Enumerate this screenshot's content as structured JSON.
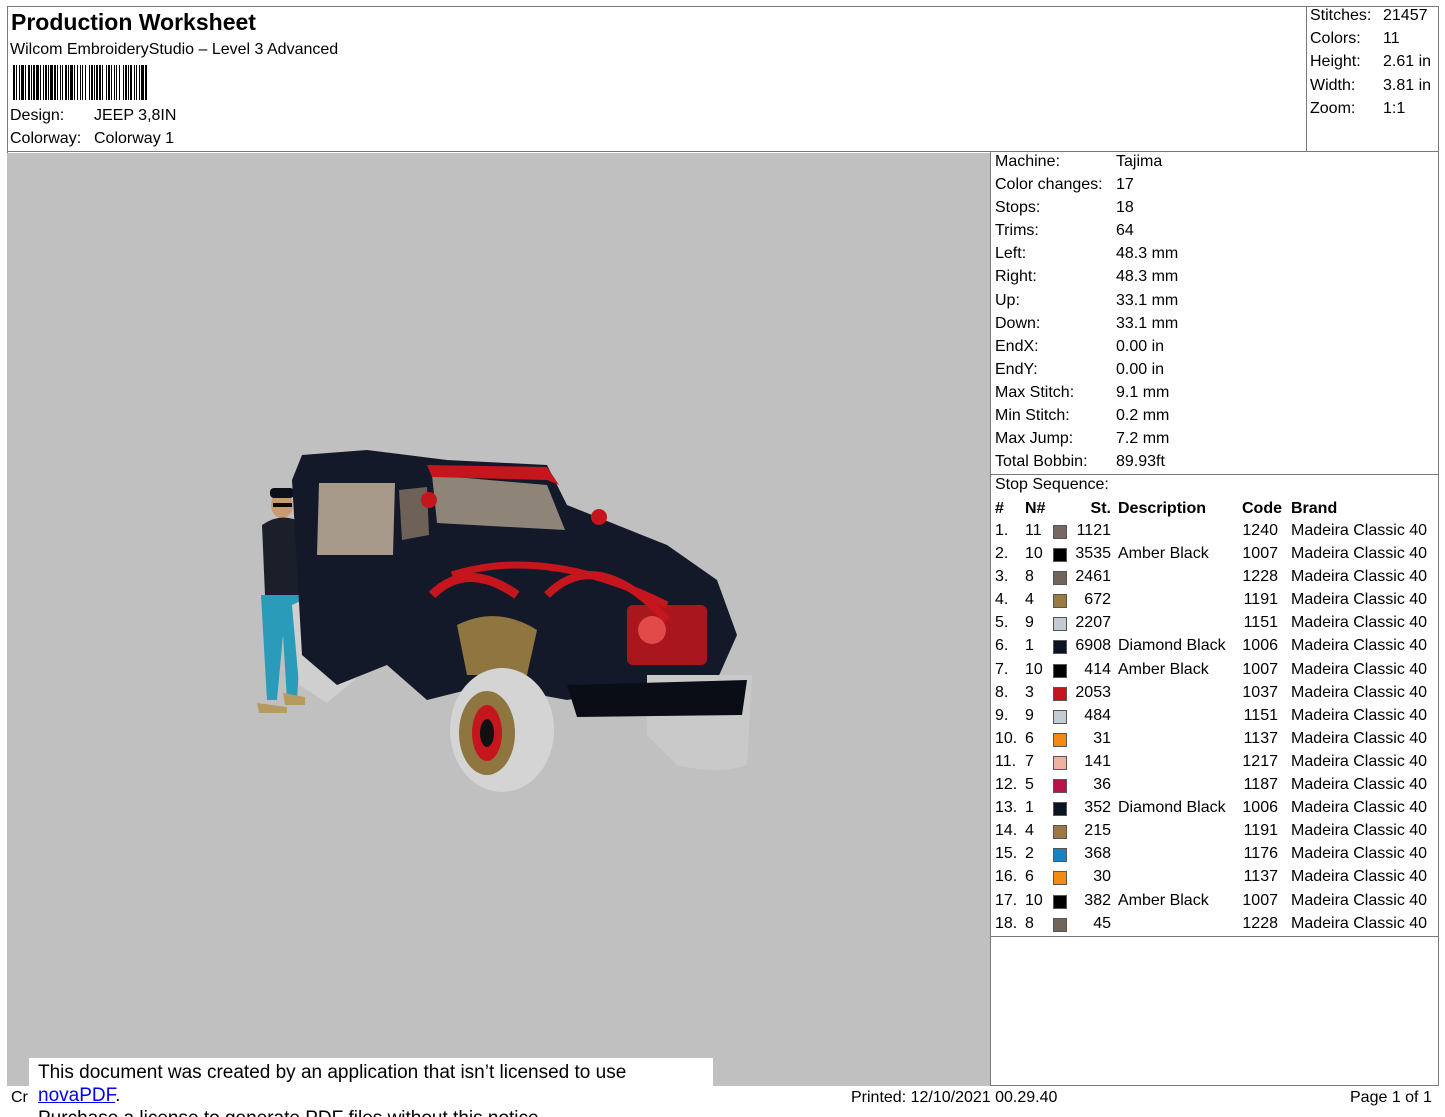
{
  "header": {
    "title": "Production Worksheet",
    "software": "Wilcom EmbroideryStudio – Level 3 Advanced",
    "design_label": "Design:",
    "design_value": "JEEP 3,8IN",
    "colorway_label": "Colorway:",
    "colorway_value": "Colorway 1"
  },
  "stats": [
    {
      "label": "Stitches:",
      "value": "21457"
    },
    {
      "label": "Colors:",
      "value": "11"
    },
    {
      "label": "Height:",
      "value": "2.61 in"
    },
    {
      "label": "Width:",
      "value": "3.81 in"
    },
    {
      "label": "Zoom:",
      "value": "1:1"
    }
  ],
  "machine": [
    {
      "label": "Machine:",
      "value": "Tajima"
    },
    {
      "label": "Color changes:",
      "value": "17"
    },
    {
      "label": "Stops:",
      "value": "18"
    },
    {
      "label": "Trims:",
      "value": "64"
    },
    {
      "label": "Left:",
      "value": "48.3 mm"
    },
    {
      "label": "Right:",
      "value": "48.3 mm"
    },
    {
      "label": "Up:",
      "value": "33.1 mm"
    },
    {
      "label": "Down:",
      "value": "33.1 mm"
    },
    {
      "label": "EndX:",
      "value": "0.00 in"
    },
    {
      "label": "EndY:",
      "value": "0.00 in"
    },
    {
      "label": "Max Stitch:",
      "value": "9.1 mm"
    },
    {
      "label": "Min Stitch:",
      "value": "0.2 mm"
    },
    {
      "label": "Max Jump:",
      "value": "7.2 mm"
    },
    {
      "label": "Total Bobbin:",
      "value": "89.93ft"
    }
  ],
  "stop_sequence": {
    "label": "Stop Sequence:",
    "columns": {
      "idx": "#",
      "n": "N#",
      "st": "St.",
      "desc": "Description",
      "code": "Code",
      "brand": "Brand"
    },
    "rows": [
      {
        "idx": "1.",
        "n": "11",
        "color": "#766860",
        "st": "1121",
        "desc": "",
        "code": "1240",
        "brand": "Madeira Classic 40"
      },
      {
        "idx": "2.",
        "n": "10",
        "color": "#000000",
        "st": "3535",
        "desc": "Amber Black",
        "code": "1007",
        "brand": "Madeira Classic 40"
      },
      {
        "idx": "3.",
        "n": "8",
        "color": "#6f655c",
        "st": "2461",
        "desc": "",
        "code": "1228",
        "brand": "Madeira Classic 40"
      },
      {
        "idx": "4.",
        "n": "4",
        "color": "#9a7a42",
        "st": "672",
        "desc": "",
        "code": "1191",
        "brand": "Madeira Classic 40"
      },
      {
        "idx": "5.",
        "n": "9",
        "color": "#c4cbd2",
        "st": "2207",
        "desc": "",
        "code": "1151",
        "brand": "Madeira Classic 40"
      },
      {
        "idx": "6.",
        "n": "1",
        "color": "#0b1422",
        "st": "6908",
        "desc": "Diamond Black",
        "code": "1006",
        "brand": "Madeira Classic 40"
      },
      {
        "idx": "7.",
        "n": "10",
        "color": "#000000",
        "st": "414",
        "desc": "Amber Black",
        "code": "1007",
        "brand": "Madeira Classic 40"
      },
      {
        "idx": "8.",
        "n": "3",
        "color": "#c4161c",
        "st": "2053",
        "desc": "",
        "code": "1037",
        "brand": "Madeira Classic 40"
      },
      {
        "idx": "9.",
        "n": "9",
        "color": "#c4cbd2",
        "st": "484",
        "desc": "",
        "code": "1151",
        "brand": "Madeira Classic 40"
      },
      {
        "idx": "10.",
        "n": "6",
        "color": "#f58a12",
        "st": "31",
        "desc": "",
        "code": "1137",
        "brand": "Madeira Classic 40"
      },
      {
        "idx": "11.",
        "n": "7",
        "color": "#f0b2a0",
        "st": "141",
        "desc": "",
        "code": "1217",
        "brand": "Madeira Classic 40"
      },
      {
        "idx": "12.",
        "n": "5",
        "color": "#b8134a",
        "st": "36",
        "desc": "",
        "code": "1187",
        "brand": "Madeira Classic 40"
      },
      {
        "idx": "13.",
        "n": "1",
        "color": "#0b1422",
        "st": "352",
        "desc": "Diamond Black",
        "code": "1006",
        "brand": "Madeira Classic 40"
      },
      {
        "idx": "14.",
        "n": "4",
        "color": "#9a7a42",
        "st": "215",
        "desc": "",
        "code": "1191",
        "brand": "Madeira Classic 40"
      },
      {
        "idx": "15.",
        "n": "2",
        "color": "#1a82c0",
        "st": "368",
        "desc": "",
        "code": "1176",
        "brand": "Madeira Classic 40"
      },
      {
        "idx": "16.",
        "n": "6",
        "color": "#f58a12",
        "st": "30",
        "desc": "",
        "code": "1137",
        "brand": "Madeira Classic 40"
      },
      {
        "idx": "17.",
        "n": "10",
        "color": "#000000",
        "st": "382",
        "desc": "Amber Black",
        "code": "1007",
        "brand": "Madeira Classic 40"
      },
      {
        "idx": "18.",
        "n": "8",
        "color": "#6f655c",
        "st": "45",
        "desc": "",
        "code": "1228",
        "brand": "Madeira Classic 40"
      }
    ]
  },
  "notice": {
    "line1_prefix": "This document was created by an application that isn’t licensed to use ",
    "link": "novaPDF",
    "line1_suffix": ".",
    "line2": "Purchase a license to generate PDF files without this notice."
  },
  "footer": {
    "left_fragment": "Cr",
    "printed": "Printed: 12/10/2021 00.29.40",
    "page": "Page 1 of 1"
  },
  "colors": {
    "preview_bg": "#c0c0c0",
    "border": "#7a7a7a"
  }
}
